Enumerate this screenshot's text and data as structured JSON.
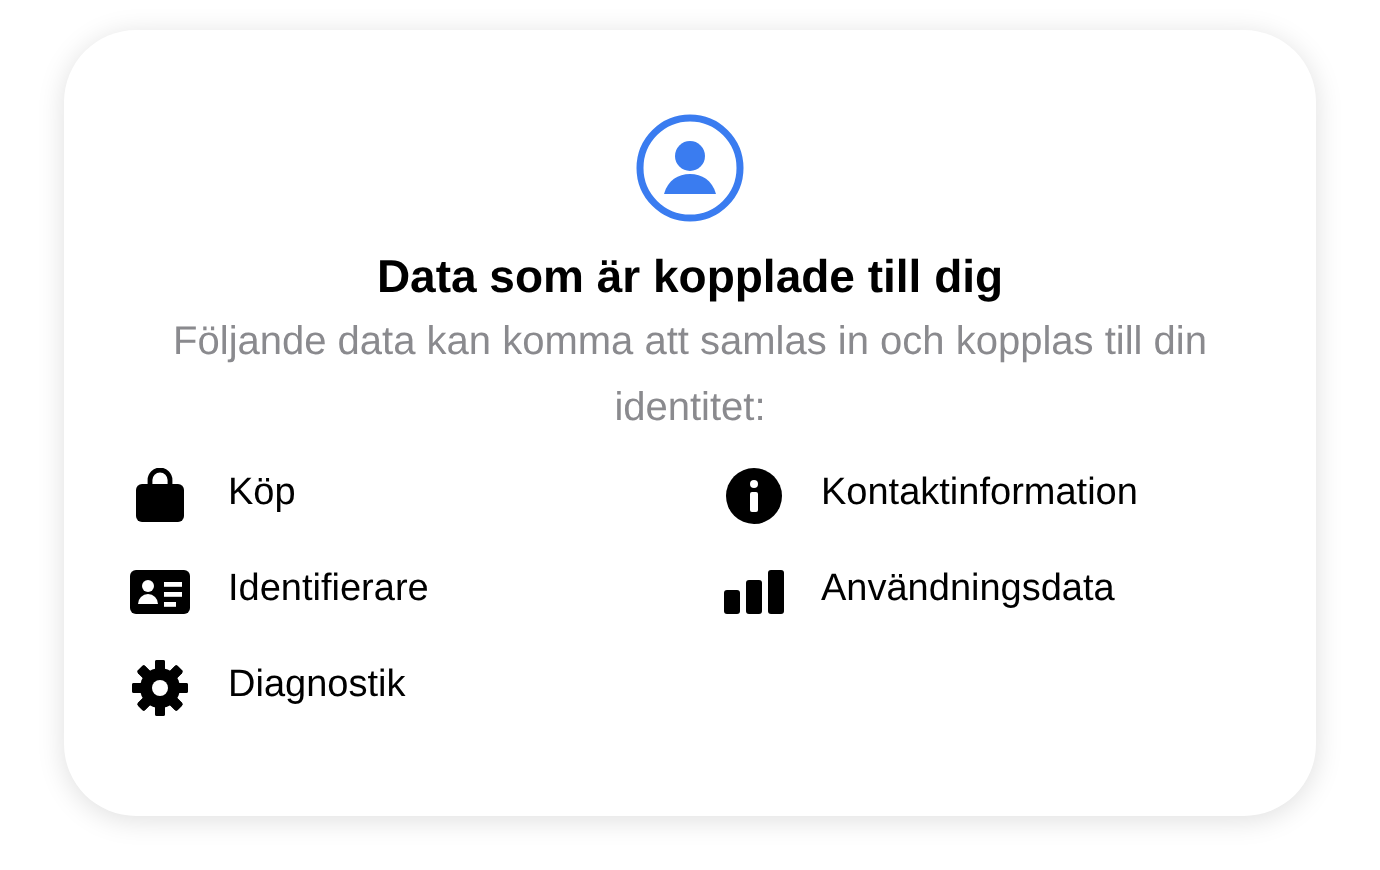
{
  "card": {
    "title": "Data som är kopplade till dig",
    "subtitle": "Följande data kan komma att samlas in och kopplas till din identitet:",
    "items": [
      {
        "kind": "bag",
        "label": "Köp"
      },
      {
        "kind": "info",
        "label": "Kontaktinformation"
      },
      {
        "kind": "idcard",
        "label": "Identifierare"
      },
      {
        "kind": "bars",
        "label": "Användningsdata"
      },
      {
        "kind": "gear",
        "label": "Diagnostik"
      }
    ]
  }
}
